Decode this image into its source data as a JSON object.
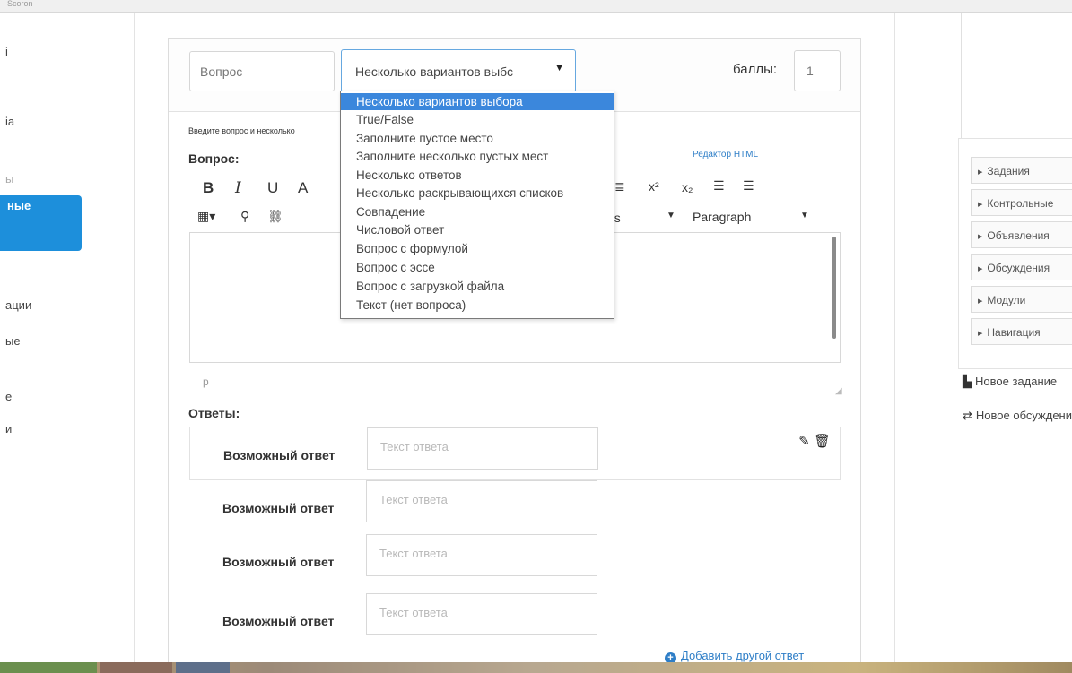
{
  "top_cut_text": "Scoron",
  "left_nav": [
    {
      "label": "i",
      "faint": false
    },
    {
      "label": "ia",
      "faint": false
    },
    {
      "label": "ы",
      "faint": true
    },
    {
      "label": "ные",
      "active": true
    },
    {
      "label": "ации",
      "faint": false
    },
    {
      "label": "ые",
      "faint": false
    },
    {
      "label": "е",
      "faint": false
    },
    {
      "label": "и",
      "faint": false
    }
  ],
  "question": {
    "name_value": "Вопрос",
    "type_selected_visible": "Несколько вариантов выбс",
    "points_label": "баллы:",
    "points_value": "1",
    "instructions": "Введите вопрос и несколько",
    "question_label": "Вопрос:",
    "html_editor_link": "Редактор HTML",
    "status_tag": "p",
    "answers_label": "Ответы:",
    "answers": [
      {
        "label": "Возможный ответ",
        "placeholder": "Текст ответа"
      },
      {
        "label": "Возможный ответ",
        "placeholder": "Текст ответа"
      },
      {
        "label": "Возможный ответ",
        "placeholder": "Текст ответа"
      },
      {
        "label": "Возможный ответ",
        "placeholder": "Текст ответа"
      }
    ],
    "add_answer": "Добавить другой ответ"
  },
  "toolbar": {
    "bold": "B",
    "italic": "I",
    "underline": "U",
    "font_color": "A",
    "align": "≣",
    "superscript": "x²",
    "subscript": "x₂",
    "bullet_list": "☰",
    "numbered_list": "☰",
    "table": "▦▾",
    "link": "⚲",
    "unlink": "⛓",
    "styles_tail": "es",
    "paragraph": "Paragraph"
  },
  "type_options": [
    "Несколько вариантов выбора",
    "True/False",
    "Заполните пустое место",
    "Заполните несколько пустых мест",
    "Несколько ответов",
    "Несколько раскрывающихся списков",
    "Совпадение",
    "Числовой ответ",
    "Вопрос с формулой",
    "Вопрос с эссе",
    "Вопрос с загрузкой файла",
    "Текст (нет вопроса)"
  ],
  "right_panel": {
    "items": [
      "Задания",
      "Контрольные",
      "Объявления",
      "Обсуждения",
      "Модули",
      "Навигация"
    ],
    "links": [
      {
        "icon": "document-icon",
        "label": "Новое задание"
      },
      {
        "icon": "discussion-icon",
        "label": "Новое обсуждение"
      }
    ]
  },
  "colors": {
    "accent": "#1d8fdb",
    "link": "#2e7ec7",
    "dropdown_selected": "#3b87dc"
  }
}
